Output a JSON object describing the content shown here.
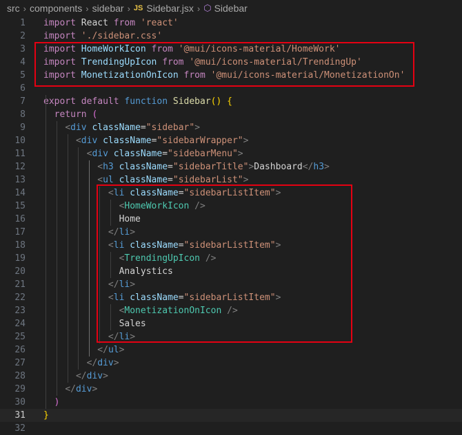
{
  "breadcrumb": {
    "items": [
      "src",
      "components",
      "sidebar",
      "Sidebar.jsx",
      "Sidebar"
    ],
    "file_badge": "JS"
  },
  "colors": {
    "keyword": "#569cd6",
    "control": "#c586c0",
    "string": "#ce9178",
    "function": "#dcdcaa",
    "component": "#4ec9b0",
    "attribute": "#9cdcfe",
    "highlight_box": "#e60012"
  },
  "cursor_line": 31,
  "lines": [
    {
      "n": 1,
      "tokens": [
        [
          "kw2",
          "import"
        ],
        [
          "txt",
          " React "
        ],
        [
          "kw2",
          "from"
        ],
        [
          "txt",
          " "
        ],
        [
          "str",
          "'react'"
        ]
      ]
    },
    {
      "n": 2,
      "tokens": [
        [
          "kw2",
          "import"
        ],
        [
          "txt",
          " "
        ],
        [
          "str",
          "'./sidebar.css'"
        ]
      ]
    },
    {
      "n": 3,
      "tokens": [
        [
          "kw2",
          "import"
        ],
        [
          "id",
          " HomeWorkIcon "
        ],
        [
          "kw2",
          "from"
        ],
        [
          "txt",
          " "
        ],
        [
          "str",
          "'@mui/icons-material/HomeWork'"
        ]
      ]
    },
    {
      "n": 4,
      "tokens": [
        [
          "kw2",
          "import"
        ],
        [
          "id",
          " TrendingUpIcon "
        ],
        [
          "kw2",
          "from"
        ],
        [
          "txt",
          " "
        ],
        [
          "str",
          "'@mui/icons-material/TrendingUp'"
        ]
      ]
    },
    {
      "n": 5,
      "tokens": [
        [
          "kw2",
          "import"
        ],
        [
          "id",
          " MonetizationOnIcon "
        ],
        [
          "kw2",
          "from"
        ],
        [
          "txt",
          " "
        ],
        [
          "str",
          "'@mui/icons-material/MonetizationOn'"
        ]
      ]
    },
    {
      "n": 6,
      "tokens": []
    },
    {
      "n": 7,
      "tokens": [
        [
          "kw2",
          "export"
        ],
        [
          "txt",
          " "
        ],
        [
          "kw2",
          "default"
        ],
        [
          "txt",
          " "
        ],
        [
          "kw",
          "function"
        ],
        [
          "txt",
          " "
        ],
        [
          "fn",
          "Sidebar"
        ],
        [
          "br1",
          "()"
        ],
        [
          "txt",
          " "
        ],
        [
          "br1",
          "{"
        ]
      ]
    },
    {
      "n": 8,
      "tokens": [
        [
          "txt",
          "  "
        ],
        [
          "kw2",
          "return"
        ],
        [
          "txt",
          " "
        ],
        [
          "br2",
          "("
        ]
      ]
    },
    {
      "n": 9,
      "tokens": [
        [
          "txt",
          "    "
        ],
        [
          "punc",
          "<"
        ],
        [
          "tag",
          "div"
        ],
        [
          "attr",
          " className"
        ],
        [
          "txt",
          "="
        ],
        [
          "str",
          "\"sidebar\""
        ],
        [
          "punc",
          ">"
        ]
      ]
    },
    {
      "n": 10,
      "tokens": [
        [
          "txt",
          "      "
        ],
        [
          "punc",
          "<"
        ],
        [
          "tag",
          "div"
        ],
        [
          "attr",
          " className"
        ],
        [
          "txt",
          "="
        ],
        [
          "str",
          "\"sidebarWrapper\""
        ],
        [
          "punc",
          ">"
        ]
      ]
    },
    {
      "n": 11,
      "tokens": [
        [
          "txt",
          "        "
        ],
        [
          "punc",
          "<"
        ],
        [
          "tag",
          "div"
        ],
        [
          "attr",
          " className"
        ],
        [
          "txt",
          "="
        ],
        [
          "str",
          "\"sidebarMenu\""
        ],
        [
          "punc",
          ">"
        ]
      ]
    },
    {
      "n": 12,
      "tokens": [
        [
          "txt",
          "          "
        ],
        [
          "punc",
          "<"
        ],
        [
          "tag",
          "h3"
        ],
        [
          "attr",
          " className"
        ],
        [
          "txt",
          "="
        ],
        [
          "str",
          "\"sidebarTitle\""
        ],
        [
          "punc",
          ">"
        ],
        [
          "txt",
          "Dashboard"
        ],
        [
          "punc",
          "</"
        ],
        [
          "tag",
          "h3"
        ],
        [
          "punc",
          ">"
        ]
      ]
    },
    {
      "n": 13,
      "tokens": [
        [
          "txt",
          "          "
        ],
        [
          "punc",
          "<"
        ],
        [
          "tag",
          "ul"
        ],
        [
          "attr",
          " className"
        ],
        [
          "txt",
          "="
        ],
        [
          "str",
          "\"sidebarList\""
        ],
        [
          "punc",
          ">"
        ]
      ]
    },
    {
      "n": 14,
      "tokens": [
        [
          "txt",
          "            "
        ],
        [
          "punc",
          "<"
        ],
        [
          "tag",
          "li"
        ],
        [
          "attr",
          " className"
        ],
        [
          "txt",
          "="
        ],
        [
          "str",
          "\"sidebarListItem\""
        ],
        [
          "punc",
          ">"
        ]
      ]
    },
    {
      "n": 15,
      "tokens": [
        [
          "txt",
          "              "
        ],
        [
          "punc",
          "<"
        ],
        [
          "comp",
          "HomeWorkIcon"
        ],
        [
          "txt",
          " "
        ],
        [
          "punc",
          "/>"
        ]
      ]
    },
    {
      "n": 16,
      "tokens": [
        [
          "txt",
          "              Home"
        ]
      ]
    },
    {
      "n": 17,
      "tokens": [
        [
          "txt",
          "            "
        ],
        [
          "punc",
          "</"
        ],
        [
          "tag",
          "li"
        ],
        [
          "punc",
          ">"
        ]
      ]
    },
    {
      "n": 18,
      "tokens": [
        [
          "txt",
          "            "
        ],
        [
          "punc",
          "<"
        ],
        [
          "tag",
          "li"
        ],
        [
          "attr",
          " className"
        ],
        [
          "txt",
          "="
        ],
        [
          "str",
          "\"sidebarListItem\""
        ],
        [
          "punc",
          ">"
        ]
      ]
    },
    {
      "n": 19,
      "tokens": [
        [
          "txt",
          "              "
        ],
        [
          "punc",
          "<"
        ],
        [
          "comp",
          "TrendingUpIcon"
        ],
        [
          "txt",
          " "
        ],
        [
          "punc",
          "/>"
        ]
      ]
    },
    {
      "n": 20,
      "tokens": [
        [
          "txt",
          "              Analystics"
        ]
      ]
    },
    {
      "n": 21,
      "tokens": [
        [
          "txt",
          "            "
        ],
        [
          "punc",
          "</"
        ],
        [
          "tag",
          "li"
        ],
        [
          "punc",
          ">"
        ]
      ]
    },
    {
      "n": 22,
      "tokens": [
        [
          "txt",
          "            "
        ],
        [
          "punc",
          "<"
        ],
        [
          "tag",
          "li"
        ],
        [
          "attr",
          " className"
        ],
        [
          "txt",
          "="
        ],
        [
          "str",
          "\"sidebarListItem\""
        ],
        [
          "punc",
          ">"
        ]
      ]
    },
    {
      "n": 23,
      "tokens": [
        [
          "txt",
          "              "
        ],
        [
          "punc",
          "<"
        ],
        [
          "comp",
          "MonetizationOnIcon"
        ],
        [
          "txt",
          " "
        ],
        [
          "punc",
          "/>"
        ]
      ]
    },
    {
      "n": 24,
      "tokens": [
        [
          "txt",
          "              Sales"
        ]
      ]
    },
    {
      "n": 25,
      "tokens": [
        [
          "txt",
          "            "
        ],
        [
          "punc",
          "</"
        ],
        [
          "tag",
          "li"
        ],
        [
          "punc",
          ">"
        ]
      ]
    },
    {
      "n": 26,
      "tokens": [
        [
          "txt",
          "          "
        ],
        [
          "punc",
          "</"
        ],
        [
          "tag",
          "ul"
        ],
        [
          "punc",
          ">"
        ]
      ]
    },
    {
      "n": 27,
      "tokens": [
        [
          "txt",
          "        "
        ],
        [
          "punc",
          "</"
        ],
        [
          "tag",
          "div"
        ],
        [
          "punc",
          ">"
        ]
      ]
    },
    {
      "n": 28,
      "tokens": [
        [
          "txt",
          "      "
        ],
        [
          "punc",
          "</"
        ],
        [
          "tag",
          "div"
        ],
        [
          "punc",
          ">"
        ]
      ]
    },
    {
      "n": 29,
      "tokens": [
        [
          "txt",
          "    "
        ],
        [
          "punc",
          "</"
        ],
        [
          "tag",
          "div"
        ],
        [
          "punc",
          ">"
        ]
      ]
    },
    {
      "n": 30,
      "tokens": [
        [
          "txt",
          "  "
        ],
        [
          "br2",
          ")"
        ]
      ]
    },
    {
      "n": 31,
      "tokens": [
        [
          "br1",
          "}"
        ]
      ]
    },
    {
      "n": 32,
      "tokens": []
    }
  ]
}
